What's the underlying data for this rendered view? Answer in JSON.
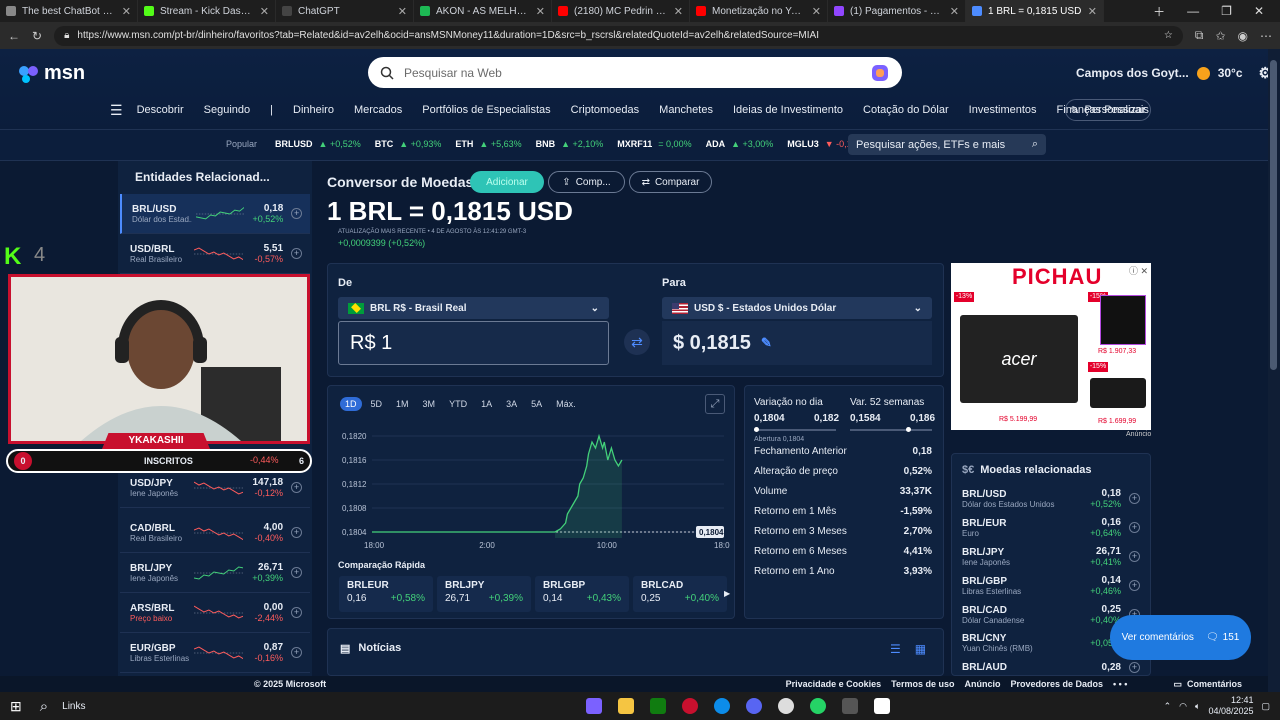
{
  "tabs": [
    {
      "title": "The best ChatBot and Widg",
      "color": "#888888"
    },
    {
      "title": "Stream - Kick Dashboard",
      "color": "#53fc18"
    },
    {
      "title": "ChatGPT",
      "color": "#444444"
    },
    {
      "title": "AKON - AS MELHORES - pl",
      "color": "#1db954"
    },
    {
      "title": "(2180) MC Pedrin do Enge",
      "color": "#ff0000"
    },
    {
      "title": "Monetização no YouTube -",
      "color": "#ff0000"
    },
    {
      "title": "(1) Pagamentos - Twitch",
      "color": "#9146ff"
    },
    {
      "title": "1 BRL = 0,1815 USD",
      "color": "#4d8cff"
    }
  ],
  "url": "https://www.msn.com/pt-br/dinheiro/favoritos?tab=Related&id=av2elh&ocid=ansMSNMoney11&duration=1D&src=b_rscrsl&relatedQuoteId=av2elh&relatedSource=MIAI",
  "brand": "msn",
  "search_placeholder": "Pesquisar na Web",
  "weather": {
    "location": "Campos dos Goyt...",
    "temp": "30°c"
  },
  "nav": [
    "Descobrir",
    "Seguindo",
    "|",
    "Dinheiro",
    "Mercados",
    "Portfólios de Especialistas",
    "Criptomoedas",
    "Manchetes",
    "Ideias de Investimento",
    "Cotação do Dólar",
    "Investimentos",
    "Finanças Pessoais"
  ],
  "personalize": "Personalizar",
  "ticker": {
    "label": "Popular",
    "items": [
      {
        "sym": "BRLUSD",
        "chg": "▲ +0,52%",
        "dir": "up"
      },
      {
        "sym": "BTC",
        "chg": "▲ +0,93%",
        "dir": "up"
      },
      {
        "sym": "ETH",
        "chg": "▲ +5,63%",
        "dir": "up"
      },
      {
        "sym": "BNB",
        "chg": "▲ +2,10%",
        "dir": "up"
      },
      {
        "sym": "MXRF11",
        "chg": "= 0,00%",
        "dir": "up"
      },
      {
        "sym": "ADA",
        "chg": "▲ +3,00%",
        "dir": "up"
      },
      {
        "sym": "MGLU3",
        "chg": "▼ -0,14%",
        "dir": "dn"
      }
    ],
    "search_placeholder": "Pesquisar ações, ETFs e mais"
  },
  "related_entities": {
    "title": "Entidades Relacionad...",
    "items": [
      {
        "sym": "BRL/USD",
        "name": "Dólar dos Estad...",
        "val": "0,18",
        "chg": "+0,52%",
        "dir": "up"
      },
      {
        "sym": "USD/BRL",
        "name": "Real Brasileiro",
        "val": "5,51",
        "chg": "-0,57%",
        "dir": "dn"
      },
      {
        "sym": "USD/JPY",
        "name": "Iene Japonês",
        "val": "147,18",
        "chg": "-0,12%",
        "dir": "dn"
      },
      {
        "sym": "CAD/BRL",
        "name": "Real Brasileiro",
        "val": "4,00",
        "chg": "-0,40%",
        "dir": "dn"
      },
      {
        "sym": "BRL/JPY",
        "name": "Iene Japonês",
        "val": "26,71",
        "chg": "+0,39%",
        "dir": "up"
      },
      {
        "sym": "ARS/BRL",
        "name": "Preço baixo",
        "val": "0,00",
        "chg": "-2,44%",
        "dir": "dn"
      },
      {
        "sym": "EUR/GBP",
        "name": "Libras Esterlinas",
        "val": "0,87",
        "chg": "-0,16%",
        "dir": "dn"
      }
    ],
    "hidden_change": "-0,44%"
  },
  "stream": {
    "platform": "K",
    "viewers": "4",
    "name": "YKAKASHII",
    "subs_label": "INSCRITOS",
    "subs_left": "0",
    "subs_right": "6"
  },
  "converter": {
    "title": "Conversor de Moedas",
    "btn_primary": "Adicionar",
    "btn_share": "Comp...",
    "btn_compare": "Comparar",
    "rate": "1 BRL = 0,1815 USD",
    "updated": "ATUALIZAÇÃO MAIS RECENTE • 4 DE AGOSTO ÀS 12:41:29 GMT-3",
    "change": "+0,0009399 (+0,52%)",
    "from_label": "De",
    "from_currency": "BRL R$ - Brasil Real",
    "from_value": "R$ 1",
    "to_label": "Para",
    "to_currency": "USD $ - Estados Unidos Dólar",
    "to_value": "$ 0,1815"
  },
  "chart_data": {
    "type": "line",
    "ranges": [
      "1D",
      "5D",
      "1M",
      "3M",
      "YTD",
      "1A",
      "3A",
      "5A",
      "Máx."
    ],
    "active_range": "1D",
    "x_ticks": [
      "18:00",
      "2:00",
      "10:00",
      "18:00"
    ],
    "y_ticks": [
      "0,1820",
      "0,1816",
      "0,1812",
      "0,1808",
      "0,1804"
    ],
    "ylim": [
      0.1803,
      0.1821
    ],
    "baseline": 0.1804,
    "baseline_label": "0,1804",
    "x": [
      0,
      0.4,
      0.52,
      0.535,
      0.55,
      0.555,
      0.565,
      0.575,
      0.585,
      0.59,
      0.6,
      0.61,
      0.615,
      0.625,
      0.635,
      0.645,
      0.655,
      0.66,
      0.67,
      0.68,
      0.69,
      0.7,
      0.71
    ],
    "values": [
      0.1804,
      0.1804,
      0.1804,
      0.18045,
      0.18055,
      0.1807,
      0.1808,
      0.1809,
      0.181,
      0.1812,
      0.1813,
      0.1815,
      0.1817,
      0.1819,
      0.1818,
      0.182,
      0.1818,
      0.1819,
      0.1816,
      0.1818,
      0.1816,
      0.1815,
      0.1816
    ]
  },
  "quick_compare": {
    "title": "Comparação Rápida",
    "items": [
      {
        "sym": "BRLEUR",
        "val": "0,16",
        "chg": "+0,58%"
      },
      {
        "sym": "BRLJPY",
        "val": "26,71",
        "chg": "+0,39%"
      },
      {
        "sym": "BRLGBP",
        "val": "0,14",
        "chg": "+0,43%"
      },
      {
        "sym": "BRLCAD",
        "val": "0,25",
        "chg": "+0,40%"
      }
    ]
  },
  "stats": {
    "day_label": "Variação no dia",
    "day_low": "0,1804",
    "day_high": "0,182",
    "wk_label": "Var. 52 semanas",
    "wk_low": "0,1584",
    "wk_high": "0,186",
    "open": "Abertura 0,1804",
    "rows": [
      {
        "k": "Fechamento Anterior",
        "v": "0,18"
      },
      {
        "k": "Alteração de preço",
        "v": "0,52%"
      },
      {
        "k": "Volume",
        "v": "33,37K"
      },
      {
        "k": "Retorno em 1 Mês",
        "v": "-1,59%"
      },
      {
        "k": "Retorno em 3 Meses",
        "v": "2,70%"
      },
      {
        "k": "Retorno em 6 Meses",
        "v": "4,41%"
      },
      {
        "k": "Retorno em 1 Ano",
        "v": "3,93%"
      }
    ]
  },
  "ad": {
    "brand": "PICHAU",
    "laptop": "acer",
    "tag": "-15%",
    "tag_left": "-13%",
    "price1": "R$ 1.907,33",
    "price_laptop": "R$ 5.199,99",
    "price2": "R$ 1.699,99",
    "label": "Anúncio"
  },
  "related_currencies": {
    "title": "Moedas relacionadas",
    "items": [
      {
        "sym": "BRL/USD",
        "name": "Dólar dos Estados Unidos",
        "val": "0,18",
        "chg": "+0,52%"
      },
      {
        "sym": "BRL/EUR",
        "name": "Euro",
        "val": "0,16",
        "chg": "+0,64%"
      },
      {
        "sym": "BRL/JPY",
        "name": "Iene Japonês",
        "val": "26,71",
        "chg": "+0,41%"
      },
      {
        "sym": "BRL/GBP",
        "name": "Libras Esterlinas",
        "val": "0,14",
        "chg": "+0,46%"
      },
      {
        "sym": "BRL/CAD",
        "name": "Dólar Canadense",
        "val": "0,25",
        "chg": "+0,40%"
      },
      {
        "sym": "BRL/CNY",
        "name": "Yuan Chinês (RMB)",
        "val": "",
        "chg": "+0,05%"
      },
      {
        "sym": "BRL/AUD",
        "name": "",
        "val": "0,28",
        "chg": ""
      }
    ]
  },
  "comments": {
    "label": "Ver comentários",
    "count": "151"
  },
  "news_title": "Notícias",
  "footer": {
    "copyright": "© 2025 Microsoft",
    "links": [
      "Privacidade e Cookies",
      "Termos de uso",
      "Anúncio",
      "Provedores de Dados",
      "• • •"
    ],
    "comments": "Comentários"
  },
  "taskbar": {
    "links": "Links",
    "time": "12:41",
    "date": "04/08/2025"
  }
}
